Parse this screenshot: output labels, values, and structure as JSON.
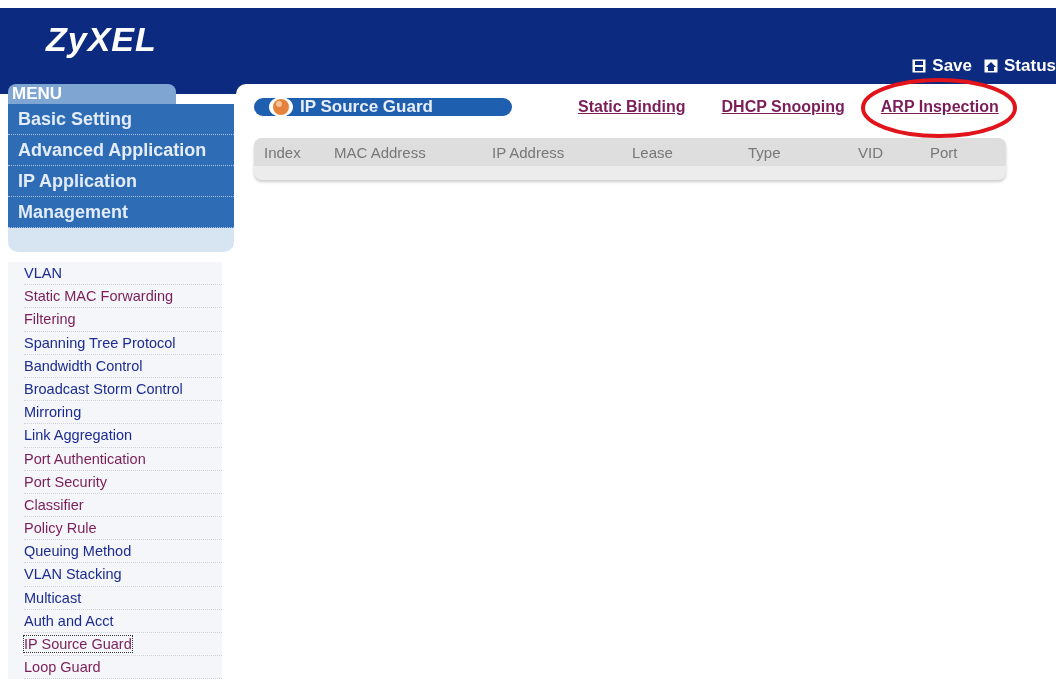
{
  "header": {
    "logo": "ZyXEL",
    "actions": [
      {
        "label": "Save",
        "kind": "save"
      },
      {
        "label": "Status",
        "kind": "status"
      }
    ]
  },
  "sidebar": {
    "menu_title": "MENU",
    "sections": [
      {
        "label": "Basic Setting"
      },
      {
        "label": "Advanced Application"
      },
      {
        "label": "IP Application"
      },
      {
        "label": "Management"
      }
    ],
    "items": [
      {
        "label": "VLAN",
        "visited": false,
        "selected": false
      },
      {
        "label": "Static MAC Forwarding",
        "visited": true,
        "selected": false
      },
      {
        "label": "Filtering",
        "visited": true,
        "selected": false
      },
      {
        "label": "Spanning Tree Protocol",
        "visited": false,
        "selected": false
      },
      {
        "label": "Bandwidth Control",
        "visited": false,
        "selected": false
      },
      {
        "label": "Broadcast Storm Control",
        "visited": false,
        "selected": false
      },
      {
        "label": "Mirroring",
        "visited": false,
        "selected": false
      },
      {
        "label": "Link Aggregation",
        "visited": false,
        "selected": false
      },
      {
        "label": "Port Authentication",
        "visited": true,
        "selected": false
      },
      {
        "label": "Port Security",
        "visited": true,
        "selected": false
      },
      {
        "label": "Classifier",
        "visited": true,
        "selected": false
      },
      {
        "label": "Policy Rule",
        "visited": true,
        "selected": false
      },
      {
        "label": "Queuing Method",
        "visited": false,
        "selected": false
      },
      {
        "label": "VLAN Stacking",
        "visited": false,
        "selected": false
      },
      {
        "label": "Multicast",
        "visited": false,
        "selected": false
      },
      {
        "label": "Auth and Acct",
        "visited": false,
        "selected": false
      },
      {
        "label": "IP Source Guard",
        "visited": true,
        "selected": true
      },
      {
        "label": "Loop Guard",
        "visited": true,
        "selected": false
      }
    ]
  },
  "page": {
    "title": "IP Source Guard",
    "links": [
      {
        "label": "Static Binding",
        "circled": false
      },
      {
        "label": "DHCP Snooping",
        "circled": false
      },
      {
        "label": "ARP Inspection",
        "circled": true
      }
    ],
    "table": {
      "columns": [
        "Index",
        "MAC Address",
        "IP Address",
        "Lease",
        "Type",
        "VID",
        "Port"
      ]
    }
  }
}
